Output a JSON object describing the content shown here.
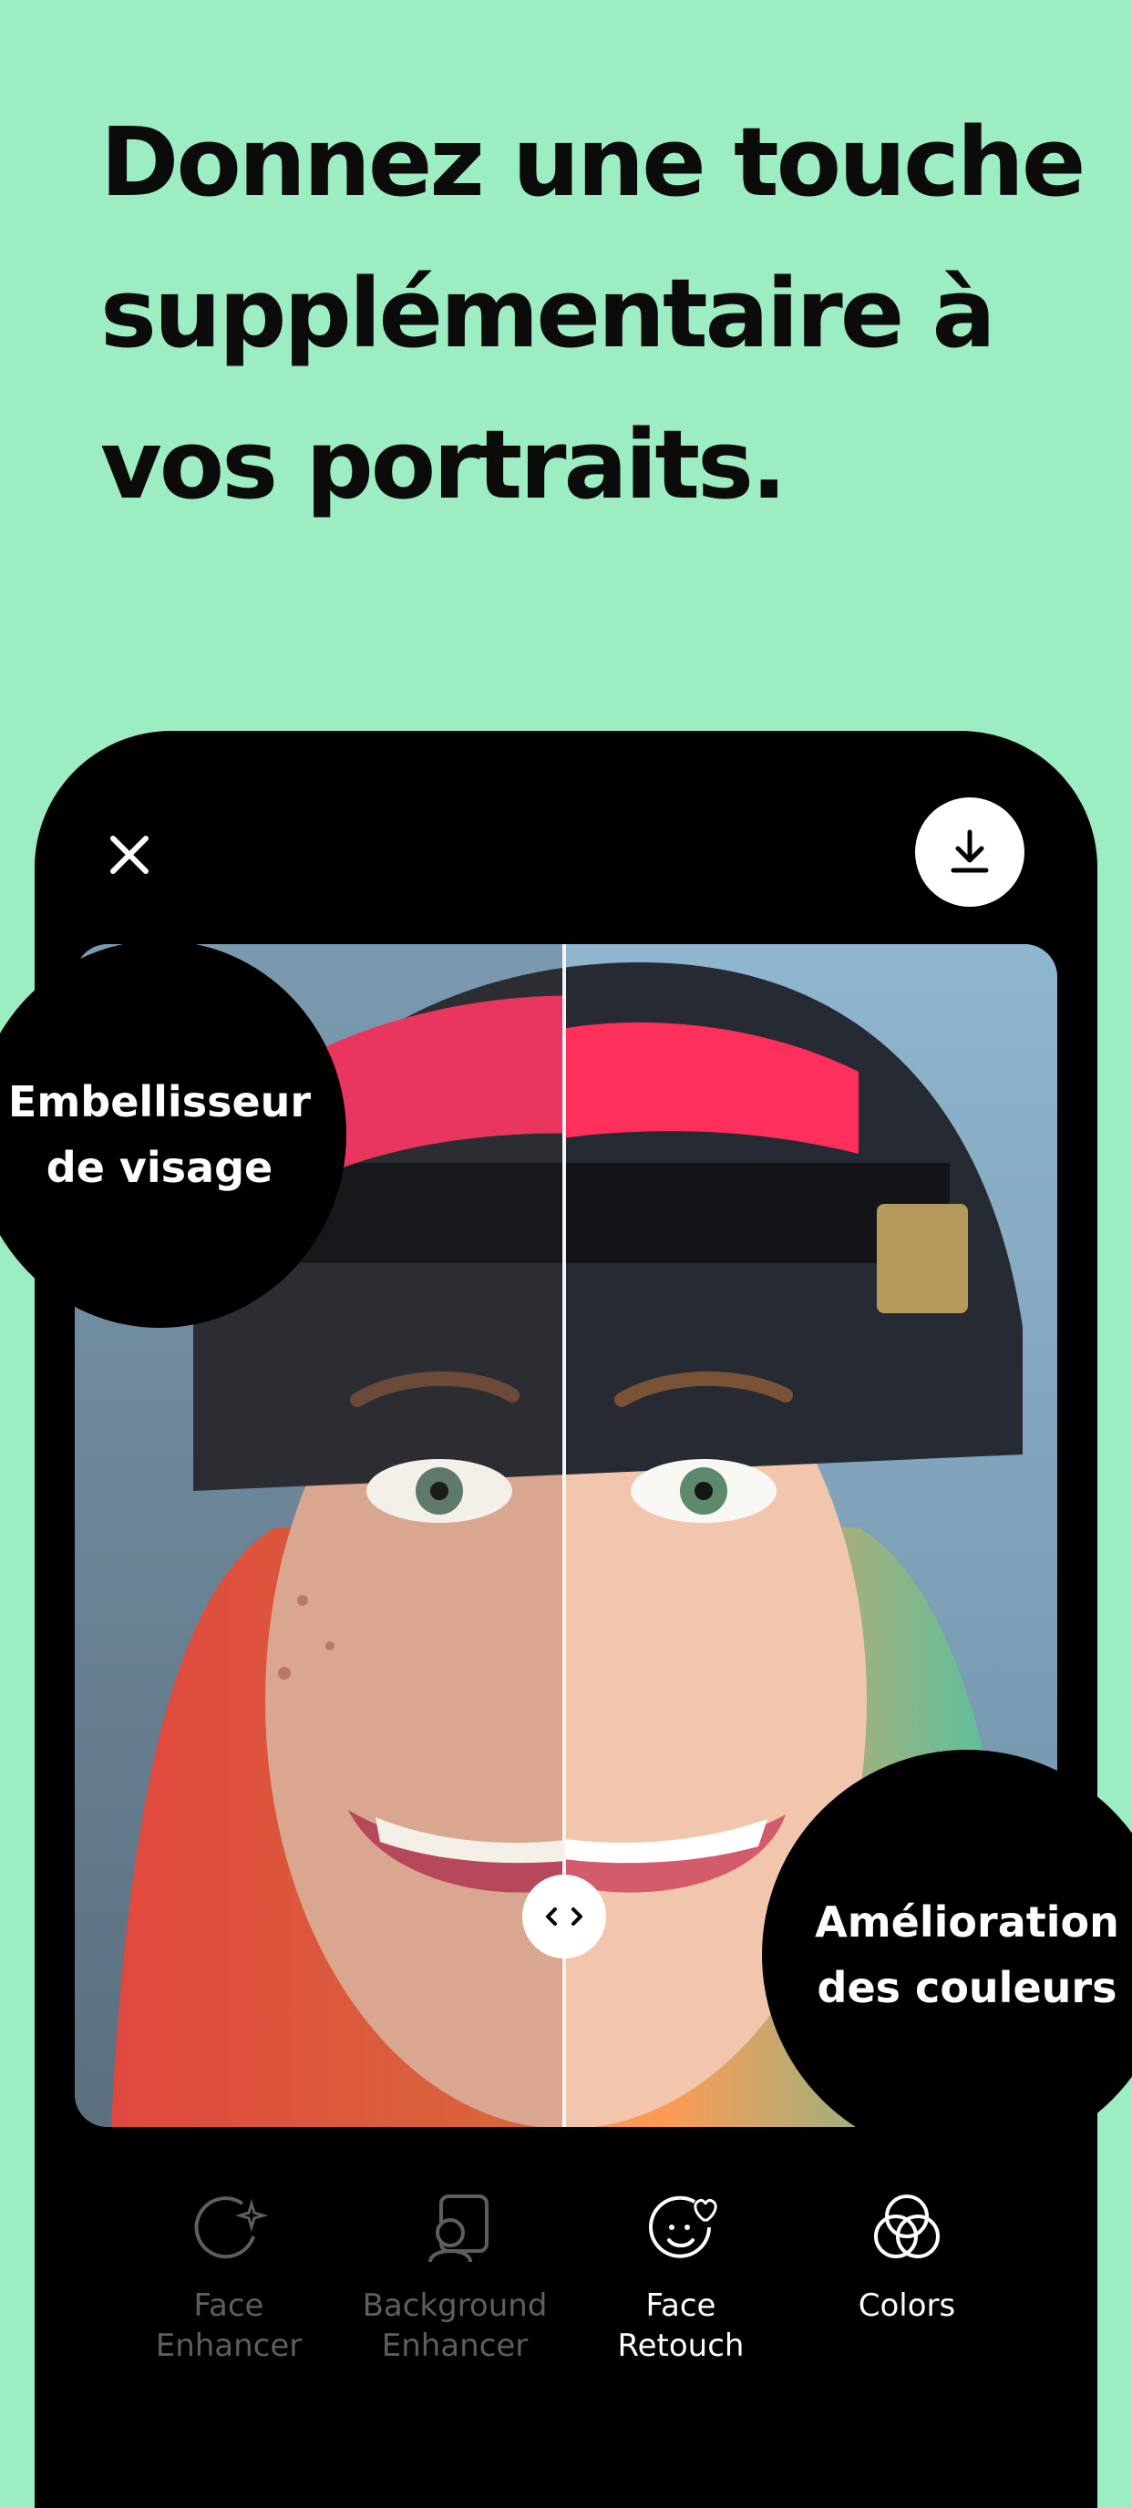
{
  "headline": "Donnez une touche\nsupplémentaire à\nvos portraits.",
  "editor": {
    "close_icon": "close-icon",
    "download_icon": "download-icon",
    "compare_handle_icon": "left-right-arrows-icon"
  },
  "callouts": {
    "left": "Embellisseur\nde visage",
    "right": "Amélioration\ndes couleurs"
  },
  "tools": [
    {
      "label": "Face\nEnhancer",
      "icon": "face-sparkle-icon",
      "active": false
    },
    {
      "label": "Background\nEnhancer",
      "icon": "background-person-icon",
      "active": false
    },
    {
      "label": "Face\nRetouch",
      "icon": "face-heart-icon",
      "active": true
    },
    {
      "label": "Colors",
      "icon": "color-circles-icon",
      "active": true
    }
  ],
  "colors": {
    "background": "#9dedc2",
    "phone": "#000000",
    "active_label": "#ffffff",
    "inactive_label": "#5e5e5e"
  }
}
